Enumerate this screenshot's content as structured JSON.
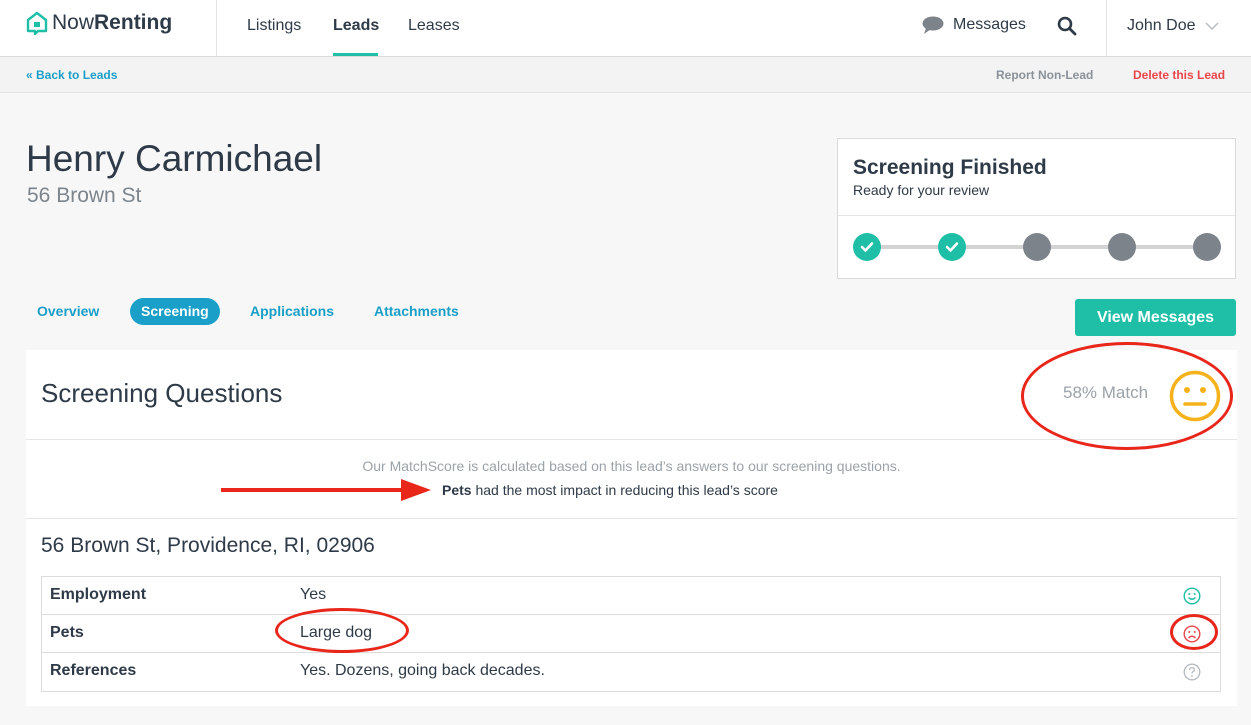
{
  "brand": {
    "name_light": "Now",
    "name_bold": "Renting"
  },
  "nav": {
    "listings": "Listings",
    "leads": "Leads",
    "leases": "Leases",
    "messages": "Messages",
    "user": "John Doe"
  },
  "subnav": {
    "back": "« Back to Leads",
    "report": "Report Non-Lead",
    "delete": "Delete this Lead"
  },
  "lead": {
    "name": "Henry Carmichael",
    "address": "56 Brown St"
  },
  "status": {
    "title": "Screening Finished",
    "subtitle": "Ready for your review",
    "steps_total": 5,
    "steps_completed": 2
  },
  "tabs": [
    {
      "label": "Overview",
      "active": false
    },
    {
      "label": "Screening",
      "active": true
    },
    {
      "label": "Applications",
      "active": false
    },
    {
      "label": "Attachments",
      "active": false
    }
  ],
  "view_messages": "View Messages",
  "screening": {
    "title": "Screening Questions",
    "match": "58% Match",
    "explain": "Our MatchScore is calculated based on this lead’s answers to our screening questions.",
    "impact_key": "Pets",
    "impact_rest": " had the most impact in reducing this lead’s score",
    "full_address": "56 Brown St, Providence, RI, 02906",
    "questions": [
      {
        "label": "Employment",
        "value": "Yes",
        "icon": "smile-icon"
      },
      {
        "label": "Pets",
        "value": "Large dog",
        "icon": "frown-icon"
      },
      {
        "label": "References",
        "value": "Yes. Dozens, going back decades.",
        "icon": "question-icon"
      }
    ]
  },
  "colors": {
    "teal": "#1fbfa7",
    "blue": "#1a9fc8",
    "red": "#e8474c",
    "annotation": "#e8261a",
    "neutral_face": "#f5b21b"
  }
}
